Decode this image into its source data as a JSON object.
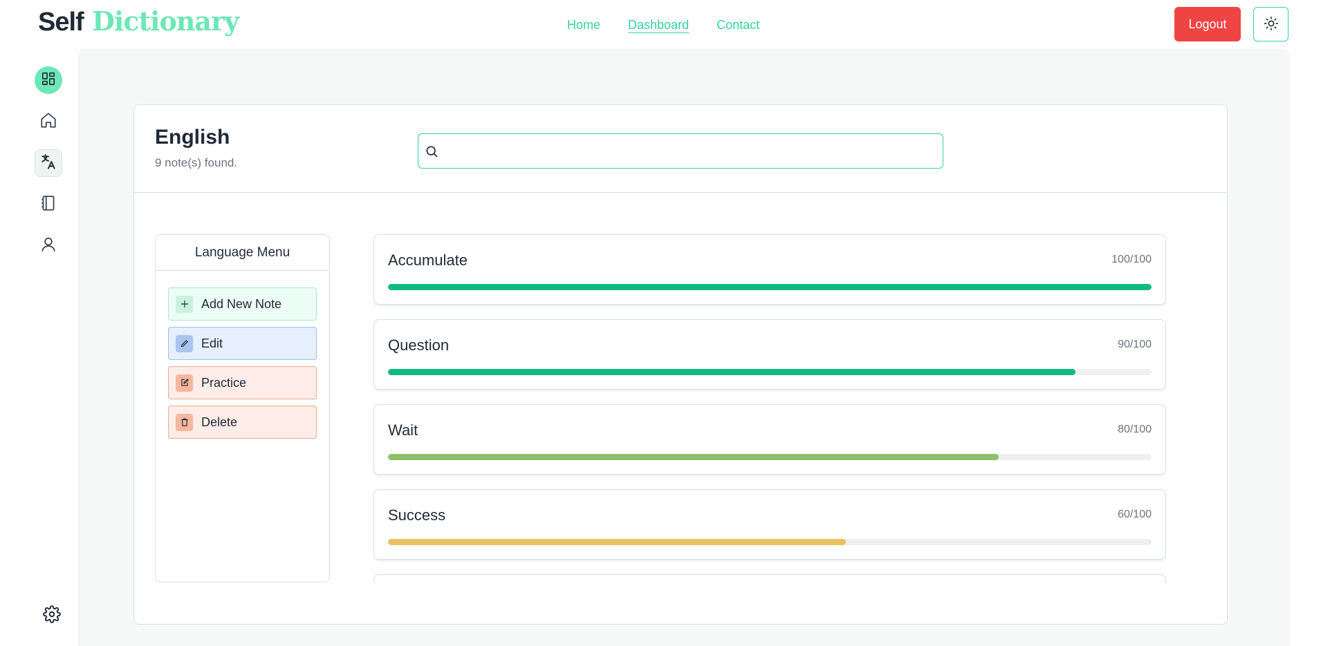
{
  "header": {
    "brand_part1": "Self",
    "brand_part2": "Dictionary",
    "nav": [
      {
        "label": "Home"
      },
      {
        "label": "Dashboard"
      },
      {
        "label": "Contact"
      }
    ],
    "logout_label": "Logout",
    "theme_icon": "sun-icon"
  },
  "sidebar": {
    "items": [
      {
        "icon": "dashboard-icon"
      },
      {
        "icon": "home-icon"
      },
      {
        "icon": "translate-icon"
      },
      {
        "icon": "notebook-icon"
      },
      {
        "icon": "user-icon"
      }
    ],
    "settings_icon": "gear-icon"
  },
  "main": {
    "language": "English",
    "notes_count": "9 note(s) found.",
    "search": {
      "value": "",
      "placeholder": ""
    },
    "menu": {
      "title": "Language Menu",
      "buttons": [
        {
          "label": "Add New Note",
          "icon": "plus-icon"
        },
        {
          "label": "Edit",
          "icon": "pencil-icon"
        },
        {
          "label": "Practice",
          "icon": "practice-icon"
        },
        {
          "label": "Delete",
          "icon": "trash-icon"
        }
      ]
    },
    "notes": [
      {
        "word": "Accumulate",
        "score": "100/100",
        "progress": 1.0,
        "color": "#10b981"
      },
      {
        "word": "Question",
        "score": "90/100",
        "progress": 0.9,
        "color": "#10b981"
      },
      {
        "word": "Wait",
        "score": "80/100",
        "progress": 0.8,
        "color": "#8ec06c"
      },
      {
        "word": "Success",
        "score": "60/100",
        "progress": 0.6,
        "color": "#e8c15f"
      }
    ]
  },
  "colors": {
    "accent": "#34d399",
    "accent_light": "#6ee7b7",
    "logout": "#ef4444"
  }
}
